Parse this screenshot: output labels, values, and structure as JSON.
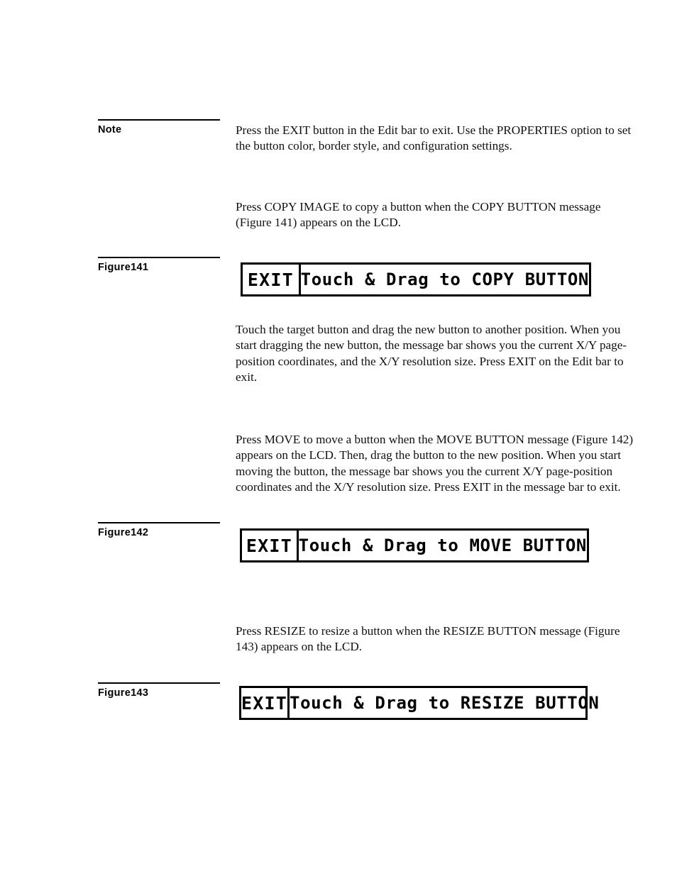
{
  "page": {
    "background": "#ffffff",
    "ink": "#000000"
  },
  "note_block": {
    "label": "Note",
    "paragraph": "Press the EXIT button in the Edit bar to exit. Use the PROPERTIES option to set the button color, border style, and configuration settings."
  },
  "copy_intro": {
    "paragraph": "Press COPY IMAGE to copy a button when the COPY BUTTON message (Figure 141) appears on the LCD."
  },
  "figure141": {
    "label": "Figure141",
    "lcd": {
      "exit_label": "EXIT",
      "message": "Touch & Drag to COPY BUTTON"
    }
  },
  "copy_body": {
    "paragraph": "Touch the target button and drag the new button to another position. When you start dragging the new button, the message bar shows you the current X/Y page-position coordinates, and the X/Y resolution size. Press EXIT on the Edit bar to exit."
  },
  "move_intro": {
    "paragraph": "Press MOVE to move a button when the MOVE BUTTON message (Figure 142) appears on the LCD. Then, drag the button to the new position. When you start moving the button, the message bar shows you the current X/Y page-position coordinates and the X/Y resolution size. Press EXIT in the message bar to exit."
  },
  "figure142": {
    "label": "Figure142",
    "lcd": {
      "exit_label": "EXIT",
      "message": "Touch & Drag to MOVE BUTTON"
    }
  },
  "resize_intro": {
    "paragraph": "Press RESIZE to resize a button when the RESIZE BUTTON message (Figure 143) appears on the LCD."
  },
  "figure143": {
    "label": "Figure143",
    "lcd": {
      "exit_label": "EXIT",
      "message": "Touch & Drag to RESIZE BUTTON"
    }
  }
}
